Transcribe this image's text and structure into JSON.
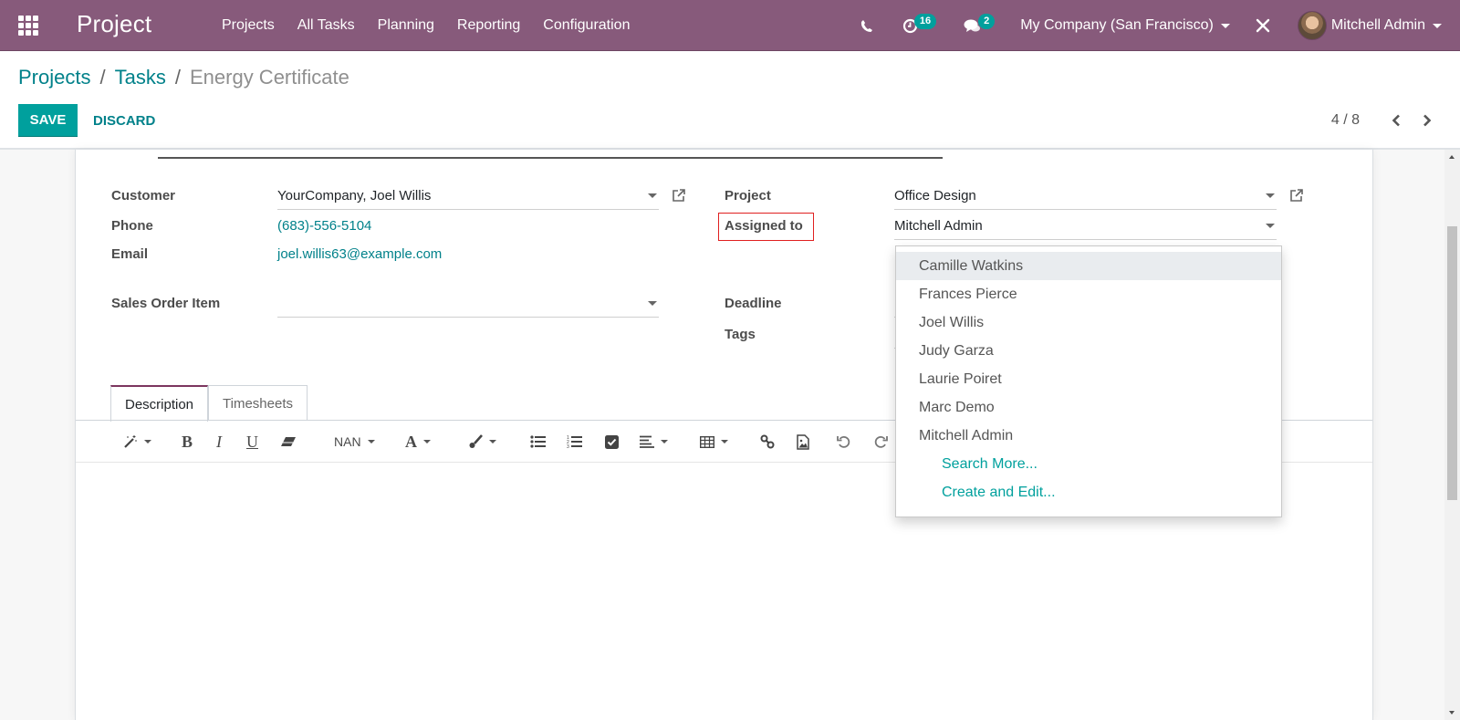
{
  "navbar": {
    "app_name": "Project",
    "menu": [
      "Projects",
      "All Tasks",
      "Planning",
      "Reporting",
      "Configuration"
    ],
    "activities_count": "16",
    "messages_count": "2",
    "company": "My Company (San Francisco)",
    "user": "Mitchell Admin",
    "colors": {
      "navbar_bg": "#875a7b",
      "badge": "#00a09d"
    }
  },
  "breadcrumb": {
    "items": [
      "Projects",
      "Tasks"
    ],
    "current": "Energy Certificate",
    "separator": "/"
  },
  "actions": {
    "save": "SAVE",
    "discard": "DISCARD"
  },
  "pager": {
    "value": "4 / 8"
  },
  "form": {
    "customer": {
      "label": "Customer",
      "value": "YourCompany, Joel Willis"
    },
    "phone": {
      "label": "Phone",
      "value": "(683)-556-5104"
    },
    "email": {
      "label": "Email",
      "value": "joel.willis63@example.com"
    },
    "sales_order_item": {
      "label": "Sales Order Item",
      "value": ""
    },
    "project": {
      "label": "Project",
      "value": "Office Design"
    },
    "assigned_to": {
      "label": "Assigned to",
      "value": "Mitchell Admin"
    },
    "deadline": {
      "label": "Deadline"
    },
    "tags": {
      "label": "Tags"
    }
  },
  "tabs": [
    "Description",
    "Timesheets"
  ],
  "editor_toolbar": {
    "font_size": "NAN"
  },
  "assigned_dropdown": {
    "options": [
      "Camille Watkins",
      "Frances Pierce",
      "Joel Willis",
      "Judy Garza",
      "Laurie Poiret",
      "Marc Demo",
      "Mitchell Admin"
    ],
    "highlighted": "Camille Watkins",
    "search_more": "Search More...",
    "create_and_edit": "Create and Edit..."
  }
}
